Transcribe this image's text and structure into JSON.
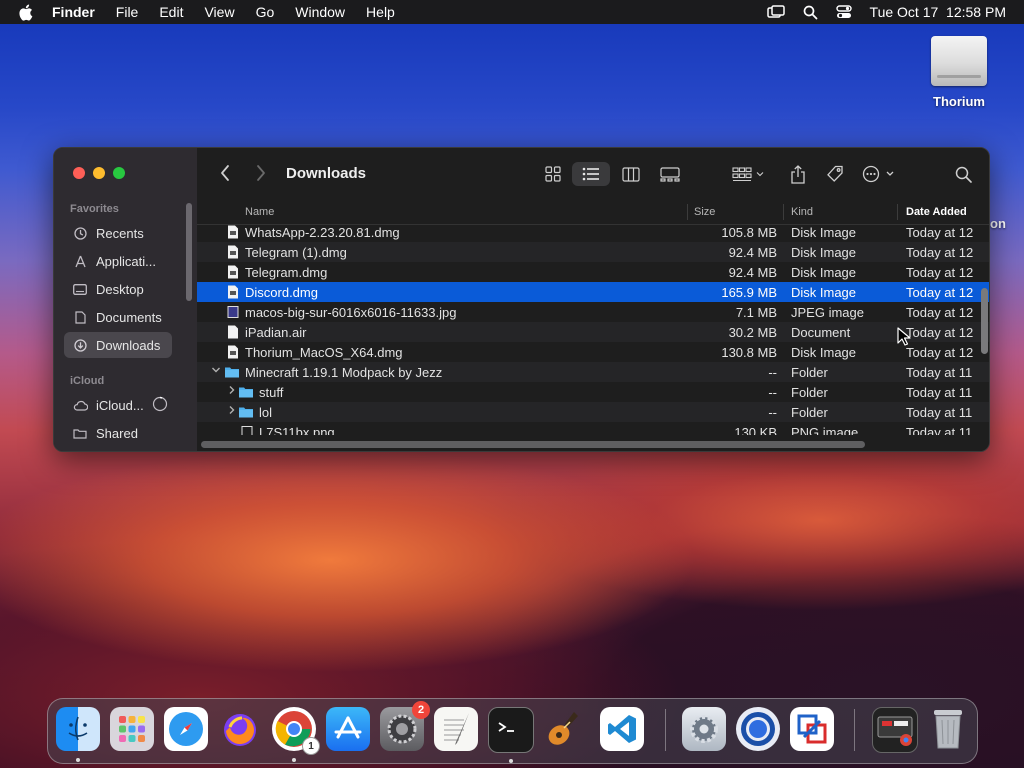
{
  "menubar": {
    "app": "Finder",
    "items": [
      "File",
      "Edit",
      "View",
      "Go",
      "Window",
      "Help"
    ],
    "datetime": "Tue Oct 17  12:58 PM"
  },
  "desktop": {
    "drive_label": "Thorium",
    "partial_label": "on"
  },
  "window": {
    "title": "Downloads",
    "sidebar": {
      "favorites_header": "Favorites",
      "favorites": [
        {
          "label": "Recents",
          "icon": "clock-icon"
        },
        {
          "label": "Applicati...",
          "icon": "applications-icon"
        },
        {
          "label": "Desktop",
          "icon": "desktop-icon"
        },
        {
          "label": "Documents",
          "icon": "document-icon"
        },
        {
          "label": "Downloads",
          "icon": "download-icon"
        }
      ],
      "icloud_header": "iCloud",
      "icloud": [
        {
          "label": "iCloud...",
          "icon": "cloud-icon"
        },
        {
          "label": "Shared",
          "icon": "shared-folder-icon"
        }
      ]
    },
    "columns": {
      "name": "Name",
      "size": "Size",
      "kind": "Kind",
      "date": "Date Added"
    },
    "rows": [
      {
        "name": "WhatsApp-2.23.20.81.dmg",
        "size": "105.8 MB",
        "kind": "Disk Image",
        "date": "Today at 12"
      },
      {
        "name": "Telegram (1).dmg",
        "size": "92.4 MB",
        "kind": "Disk Image",
        "date": "Today at 12"
      },
      {
        "name": "Telegram.dmg",
        "size": "92.4 MB",
        "kind": "Disk Image",
        "date": "Today at 12"
      },
      {
        "name": "Discord.dmg",
        "size": "165.9 MB",
        "kind": "Disk Image",
        "date": "Today at 12"
      },
      {
        "name": "macos-big-sur-6016x6016-11633.jpg",
        "size": "7.1 MB",
        "kind": "JPEG image",
        "date": "Today at 12"
      },
      {
        "name": "iPadian.air",
        "size": "30.2 MB",
        "kind": "Document",
        "date": "Today at 12"
      },
      {
        "name": "Thorium_MacOS_X64.dmg",
        "size": "130.8 MB",
        "kind": "Disk Image",
        "date": "Today at 12"
      },
      {
        "name": "Minecraft 1.19.1 Modpack by Jezz",
        "size": "--",
        "kind": "Folder",
        "date": "Today at 11"
      },
      {
        "name": "stuff",
        "size": "--",
        "kind": "Folder",
        "date": "Today at 11"
      },
      {
        "name": "lol",
        "size": "--",
        "kind": "Folder",
        "date": "Today at 11"
      },
      {
        "name": "L7S11bx.png",
        "size": "130 KB",
        "kind": "PNG image",
        "date": "Today at 11"
      }
    ]
  },
  "dock": {
    "apps": [
      {
        "name": "Finder",
        "icon": "finder-icon",
        "running": true
      },
      {
        "name": "Launchpad",
        "icon": "launchpad-icon"
      },
      {
        "name": "Safari",
        "icon": "safari-icon"
      },
      {
        "name": "Firefox",
        "icon": "firefox-icon"
      },
      {
        "name": "Chrome",
        "icon": "chrome-icon",
        "running": true,
        "badge": "1"
      },
      {
        "name": "App Store",
        "icon": "app-store-icon"
      },
      {
        "name": "System Settings",
        "icon": "settings-icon",
        "badge": "2"
      },
      {
        "name": "TextEdit",
        "icon": "textedit-icon"
      },
      {
        "name": "Terminal",
        "icon": "terminal-icon",
        "running": true
      },
      {
        "name": "GarageBand",
        "icon": "garageband-icon"
      },
      {
        "name": "VS Code",
        "icon": "vscode-icon"
      },
      {
        "name": "Utility",
        "icon": "gear-app-icon"
      },
      {
        "name": "Thorium",
        "icon": "thorium-icon"
      },
      {
        "name": "Parallels",
        "icon": "parallels-icon"
      },
      {
        "name": "Chrome Apps",
        "icon": "chrome-apps-icon"
      },
      {
        "name": "Trash",
        "icon": "trash-icon"
      }
    ]
  },
  "colors": {
    "selection": "#0a5bd8",
    "folder": "#4fb0ec",
    "badge": "#f0453a"
  }
}
